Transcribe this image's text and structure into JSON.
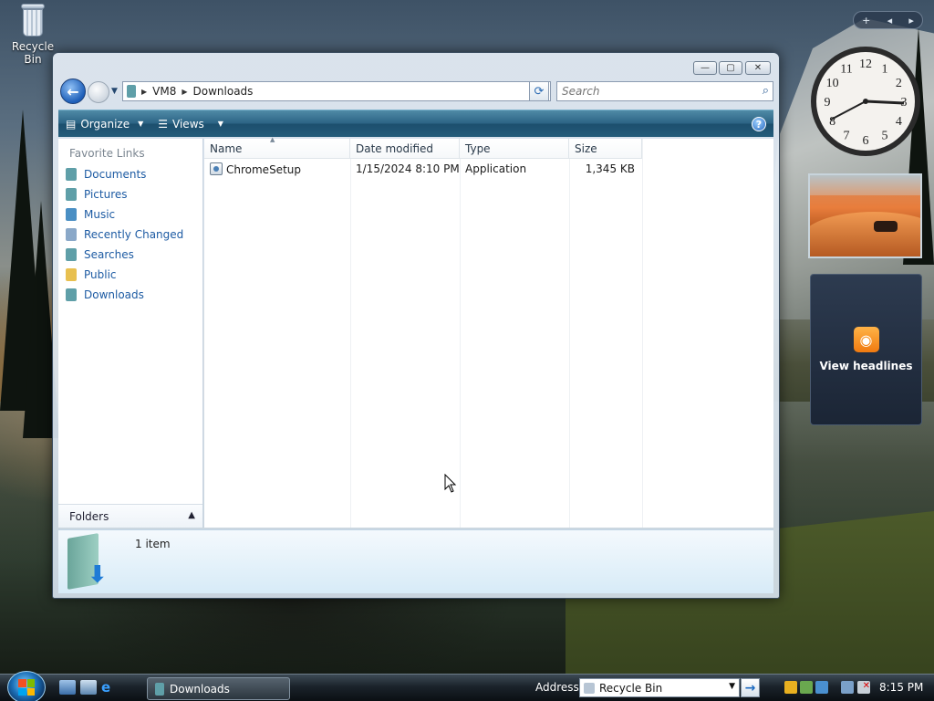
{
  "desktop": {
    "recycle_bin_label": "Recycle Bin"
  },
  "window": {
    "minimize_glyph": "—",
    "maximize_glyph": "▢",
    "close_glyph": "✕",
    "back_glyph": "←",
    "address": {
      "crumbs": [
        "VM8",
        "Downloads"
      ]
    },
    "search": {
      "placeholder": "Search"
    },
    "toolbar": {
      "organize_label": "Organize",
      "views_label": "Views",
      "help_glyph": "?"
    },
    "nav_pane": {
      "header": "Favorite Links",
      "items": [
        {
          "label": "Documents",
          "icon": "documents-icon",
          "color": "#5f9fa8"
        },
        {
          "label": "Pictures",
          "icon": "pictures-icon",
          "color": "#5f9fa8"
        },
        {
          "label": "Music",
          "icon": "music-icon",
          "color": "#4a8fc4"
        },
        {
          "label": "Recently Changed",
          "icon": "recently-changed-icon",
          "color": "#8aa8c8"
        },
        {
          "label": "Searches",
          "icon": "searches-icon",
          "color": "#5f9fa8"
        },
        {
          "label": "Public",
          "icon": "public-folder-icon",
          "color": "#e8c050"
        },
        {
          "label": "Downloads",
          "icon": "downloads-icon",
          "color": "#5f9fa8"
        }
      ],
      "folders_label": "Folders"
    },
    "columns": {
      "name": "Name",
      "date_modified": "Date modified",
      "type": "Type",
      "size": "Size"
    },
    "files": [
      {
        "name": "ChromeSetup",
        "date_modified": "1/15/2024 8:10 PM",
        "type": "Application",
        "size": "1,345 KB"
      }
    ],
    "details": {
      "item_count": "1 item"
    }
  },
  "gadgets": {
    "clock_numerals": [
      "12",
      "1",
      "2",
      "3",
      "4",
      "5",
      "6",
      "7",
      "8",
      "9",
      "10",
      "11"
    ],
    "feed_label": "View headlines",
    "add_glyph": "+"
  },
  "taskbar": {
    "task_button": "Downloads",
    "address_label": "Address",
    "address_value": "Recycle Bin",
    "time": "8:15 PM"
  },
  "colors": {
    "accent": "#1d5ba3",
    "toolbar": "#2c6485"
  }
}
